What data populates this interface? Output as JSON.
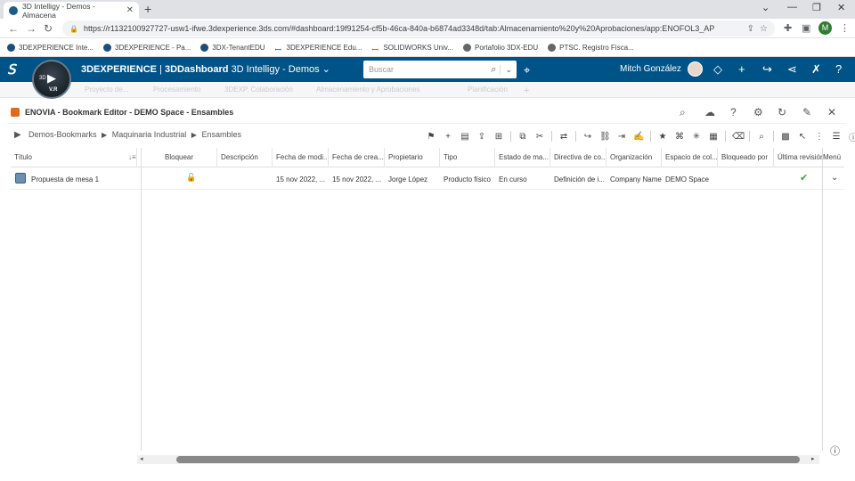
{
  "browser": {
    "tab_title": "3D Intelligy - Demos - Almacena",
    "url": "https://r1132100927727-usw1-ifwe.3dexperience.3ds.com/#dashboard:19f91254-cf5b-46ca-840a-b6874ad3348d/tab:Almacenamiento%20y%20Aprobaciones/app:ENOFOL3_AP",
    "profile_initial": "M",
    "bookmarks": [
      {
        "label": "3DEXPERIENCE Inte...",
        "icon": "3dx-icon"
      },
      {
        "label": "3DEXPERIENCE - Pa...",
        "icon": "3dx-icon"
      },
      {
        "label": "3DX-TenantEDU",
        "icon": "3dx-icon"
      },
      {
        "label": "3DEXPERIENCE Edu...",
        "icon": "ds-icon"
      },
      {
        "label": "SOLIDWORKS Univ...",
        "icon": "solidworks-icon"
      },
      {
        "label": "Portafolio 3DX-EDU",
        "icon": "globe-icon"
      },
      {
        "label": "PTSC. Registro Fisca...",
        "icon": "globe-icon"
      }
    ]
  },
  "platform": {
    "brand": "3DEXPERIENCE",
    "app": "3DDashboard",
    "dashboard": "3D Intelligy - Demos",
    "search_placeholder": "Buscar",
    "user_name": "Mitch González",
    "compass_version": "V.R",
    "compass_3d": "3D",
    "dashboard_tabs": [
      "Proyecto de...",
      "Procesamiento",
      "3DEXP. Colaboración",
      "Almacenamiento y Aprobaciones",
      "Planificación"
    ]
  },
  "widget": {
    "title": "ENOVIA - Bookmark Editor - DEMO Space - Ensambles",
    "breadcrumb": [
      "Demos-Bookmarks",
      "Maquinaria Industrial",
      "Ensambles"
    ],
    "columns": [
      "Título",
      "Bloquear",
      "Descripción",
      "Fecha de modi...",
      "Fecha de crea...",
      "Propietario",
      "Tipo",
      "Estado de ma...",
      "Directiva de co...",
      "Organización",
      "Espacio de col...",
      "Bloqueado por",
      "Última revisión",
      "Menú"
    ],
    "rows": [
      {
        "title": "Propuesta de mesa 1",
        "description": "",
        "modified": "15 nov 2022, ...",
        "created": "15 nov 2022, ...",
        "owner": "Jorge López",
        "type": "Producto físico",
        "maturity": "En curso",
        "policy": "Definición de i...",
        "organization": "Company Name",
        "collab_space": "DEMO Space",
        "locked_by": ""
      }
    ]
  },
  "colors": {
    "topbar": "#005386",
    "accent_orange": "#e06a1b",
    "check_green": "#3aa33a"
  }
}
